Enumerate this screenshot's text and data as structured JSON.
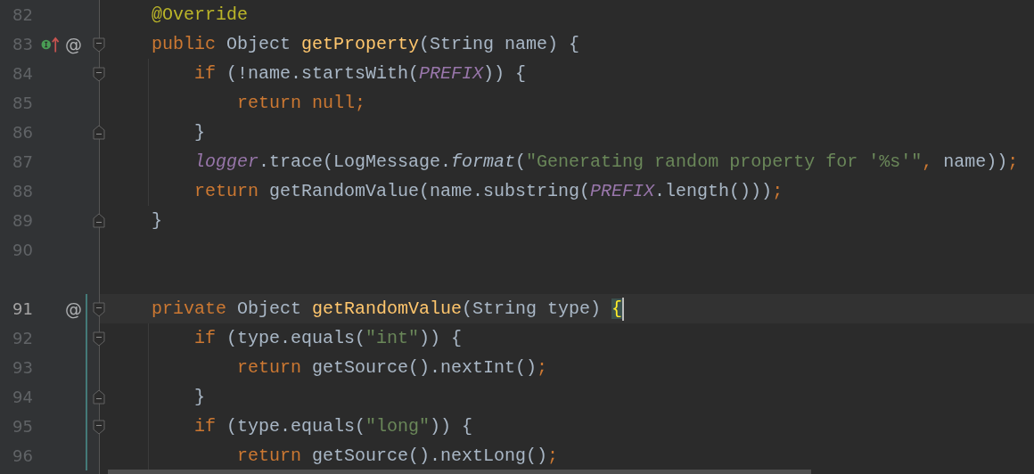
{
  "editor": {
    "lines": [
      {
        "number": "82",
        "tokens": [
          {
            "kind": "annotation",
            "text": "@Override"
          }
        ]
      },
      {
        "number": "83",
        "fold_start": true,
        "marks": [
          {
            "kind": "implements"
          },
          {
            "kind": "override",
            "text": "@"
          }
        ],
        "tokens": [
          {
            "kind": "keyword",
            "text": "public "
          },
          {
            "kind": "plain",
            "text": "Object "
          },
          {
            "kind": "method",
            "text": "getProperty"
          },
          {
            "kind": "plain",
            "text": "(String name) {"
          }
        ],
        "children": [
          {
            "number": "84",
            "fold_start": true,
            "tokens": [
              {
                "kind": "keyword",
                "text": "if "
              },
              {
                "kind": "plain",
                "text": "(!name.startsWith("
              },
              {
                "kind": "constant",
                "text": "PREFIX"
              },
              {
                "kind": "plain",
                "text": ")) {"
              }
            ],
            "children": [
              {
                "number": "85",
                "tokens": [
                  {
                    "kind": "keyword",
                    "text": "return null;"
                  }
                ]
              }
            ]
          },
          {
            "number": "86",
            "fold_end": true,
            "tokens": [
              {
                "kind": "plain",
                "text": "}"
              }
            ]
          },
          {
            "number": "87",
            "tokens": [
              {
                "kind": "static_field",
                "text": "logger"
              },
              {
                "kind": "plain",
                "text": ".trace(LogMessage."
              },
              {
                "kind": "static_method",
                "text": "format"
              },
              {
                "kind": "plain",
                "text": "("
              },
              {
                "kind": "string",
                "text": "\"Generating random property for '%s'\""
              },
              {
                "kind": "keyword",
                "text": ", "
              },
              {
                "kind": "plain",
                "text": "name))"
              },
              {
                "kind": "keyword",
                "text": ";"
              }
            ]
          },
          {
            "number": "88",
            "tokens": [
              {
                "kind": "keyword",
                "text": "return "
              },
              {
                "kind": "plain",
                "text": "getRandomValue(name.substring("
              },
              {
                "kind": "constant",
                "text": "PREFIX"
              },
              {
                "kind": "plain",
                "text": ".length()))"
              },
              {
                "kind": "keyword",
                "text": ";"
              }
            ]
          }
        ]
      },
      {
        "number": "89",
        "fold_end": true,
        "tokens": [
          {
            "kind": "plain",
            "text": "}"
          }
        ]
      },
      {
        "number": "90"
      },
      {
        "number": "91",
        "gap_before": true,
        "current": true,
        "changed": true,
        "caret": true,
        "fold_start": true,
        "marks": [
          {
            "kind": "override",
            "text": "@"
          }
        ],
        "tokens": [
          {
            "kind": "keyword",
            "text": "private "
          },
          {
            "kind": "plain",
            "text": "Object "
          },
          {
            "kind": "method",
            "text": "getRandomValue"
          },
          {
            "kind": "plain",
            "text": "(String type) "
          },
          {
            "kind": "brace_match",
            "text": "{"
          }
        ],
        "children": [
          {
            "number": "92",
            "changed": true,
            "fold_start": true,
            "tokens": [
              {
                "kind": "keyword",
                "text": "if "
              },
              {
                "kind": "plain",
                "text": "(type.equals("
              },
              {
                "kind": "string",
                "text": "\"int\""
              },
              {
                "kind": "plain",
                "text": ")) {"
              }
            ],
            "children": [
              {
                "number": "93",
                "changed": true,
                "tokens": [
                  {
                    "kind": "keyword",
                    "text": "return "
                  },
                  {
                    "kind": "plain",
                    "text": "getSource().nextInt()"
                  },
                  {
                    "kind": "keyword",
                    "text": ";"
                  }
                ]
              }
            ]
          },
          {
            "number": "94",
            "changed": true,
            "fold_end": true,
            "tokens": [
              {
                "kind": "plain",
                "text": "}"
              }
            ]
          },
          {
            "number": "95",
            "changed": true,
            "fold_start": true,
            "tokens": [
              {
                "kind": "keyword",
                "text": "if "
              },
              {
                "kind": "plain",
                "text": "(type.equals("
              },
              {
                "kind": "string",
                "text": "\"long\""
              },
              {
                "kind": "plain",
                "text": ")) {"
              }
            ],
            "children": [
              {
                "number": "96",
                "changed": true,
                "tokens": [
                  {
                    "kind": "keyword",
                    "text": "return "
                  },
                  {
                    "kind": "plain",
                    "text": "getSource().nextLong()"
                  },
                  {
                    "kind": "keyword",
                    "text": ";"
                  }
                ]
              }
            ]
          }
        ]
      }
    ]
  }
}
